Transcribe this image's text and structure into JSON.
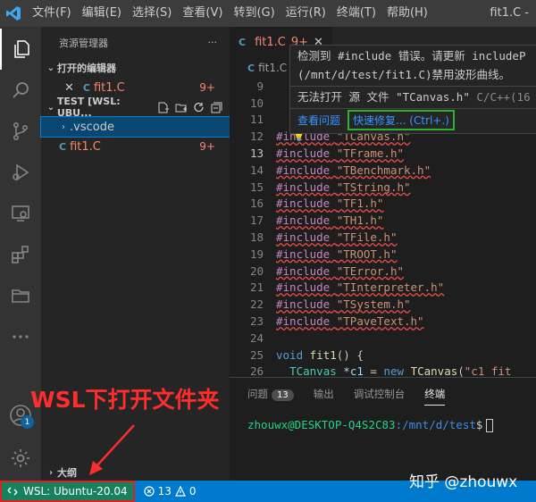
{
  "titlebar": {
    "menu": [
      "文件(F)",
      "编辑(E)",
      "选择(S)",
      "查看(V)",
      "转到(G)",
      "运行(R)",
      "终端(T)",
      "帮助(H)"
    ],
    "window_title": "fit1.C -"
  },
  "activity": {
    "items": [
      "explorer-icon",
      "search-icon",
      "source-control-icon",
      "run-debug-icon",
      "remote-explorer-icon",
      "extensions-icon",
      "folder-icon",
      "more-icon",
      "account-icon",
      "settings-icon"
    ],
    "account_badge": "1"
  },
  "sidebar": {
    "title": "资源管理器",
    "more": "···",
    "open_editors_label": "打开的编辑器",
    "open_editor_file": "fit1.C",
    "open_editor_errors": "9+",
    "workspace_label": "TEST [WSL: UBU...",
    "folder_vscode": ".vscode",
    "file_fit1": "fit1.C",
    "file_errors": "9+",
    "outline_label": "大纲"
  },
  "editor": {
    "tab_label": "fit1.C",
    "tab_errors": "9+",
    "breadcrumb": "fit1.C",
    "current_line": "13",
    "lines": [
      {
        "n": "9",
        "t": ""
      },
      {
        "n": "10",
        "t": ""
      },
      {
        "n": "11",
        "t": ""
      },
      {
        "n": "12",
        "t": "#include \"TCanvas.h\""
      },
      {
        "n": "13",
        "t": "#include \"TFrame.h\""
      },
      {
        "n": "14",
        "t": "#include \"TBenchmark.h\""
      },
      {
        "n": "15",
        "t": "#include \"TString.h\""
      },
      {
        "n": "16",
        "t": "#include \"TF1.h\""
      },
      {
        "n": "17",
        "t": "#include \"TH1.h\""
      },
      {
        "n": "18",
        "t": "#include \"TFile.h\""
      },
      {
        "n": "19",
        "t": "#include \"TROOT.h\""
      },
      {
        "n": "20",
        "t": "#include \"TError.h\""
      },
      {
        "n": "21",
        "t": "#include \"TInterpreter.h\""
      },
      {
        "n": "22",
        "t": "#include \"TSystem.h\""
      },
      {
        "n": "23",
        "t": "#include \"TPaveText.h\""
      },
      {
        "n": "24",
        "t": ""
      },
      {
        "n": "25",
        "t": "void fit1() {"
      },
      {
        "n": "26",
        "t": "  TCanvas *c1 = new TCanvas(\"c1_fit"
      }
    ]
  },
  "hover": {
    "line1": "检测到 #include 错误。请更新 includeP",
    "line2": "(/mnt/d/test/fit1.C)禁用波形曲线。",
    "line3_msg": "无法打开 源 文件 \"TCanvas.h\"",
    "line3_src": "C/C++(16",
    "view_problem": "查看问题",
    "quick_fix": "快速修复... (Ctrl+.)"
  },
  "panel": {
    "tabs": [
      "问题",
      "输出",
      "调试控制台",
      "终端"
    ],
    "problems_count": "13",
    "active_tab": "终端",
    "prompt_user": "zhouwx@DESKTOP-Q4S2C83",
    "prompt_path": ":/mnt/d/test",
    "prompt_suffix": "$"
  },
  "statusbar": {
    "remote_label": "WSL: Ubuntu-20.04",
    "errors": "13",
    "warnings": "0"
  },
  "annotation": {
    "text": "WSL下打开文件夹",
    "color": "#ff2d2d"
  },
  "watermark": "知乎 @zhouwx",
  "colors": {
    "accent": "#007acc",
    "remote": "#16825d",
    "error": "#f48771",
    "quickfix_border": "#2bb32b"
  }
}
